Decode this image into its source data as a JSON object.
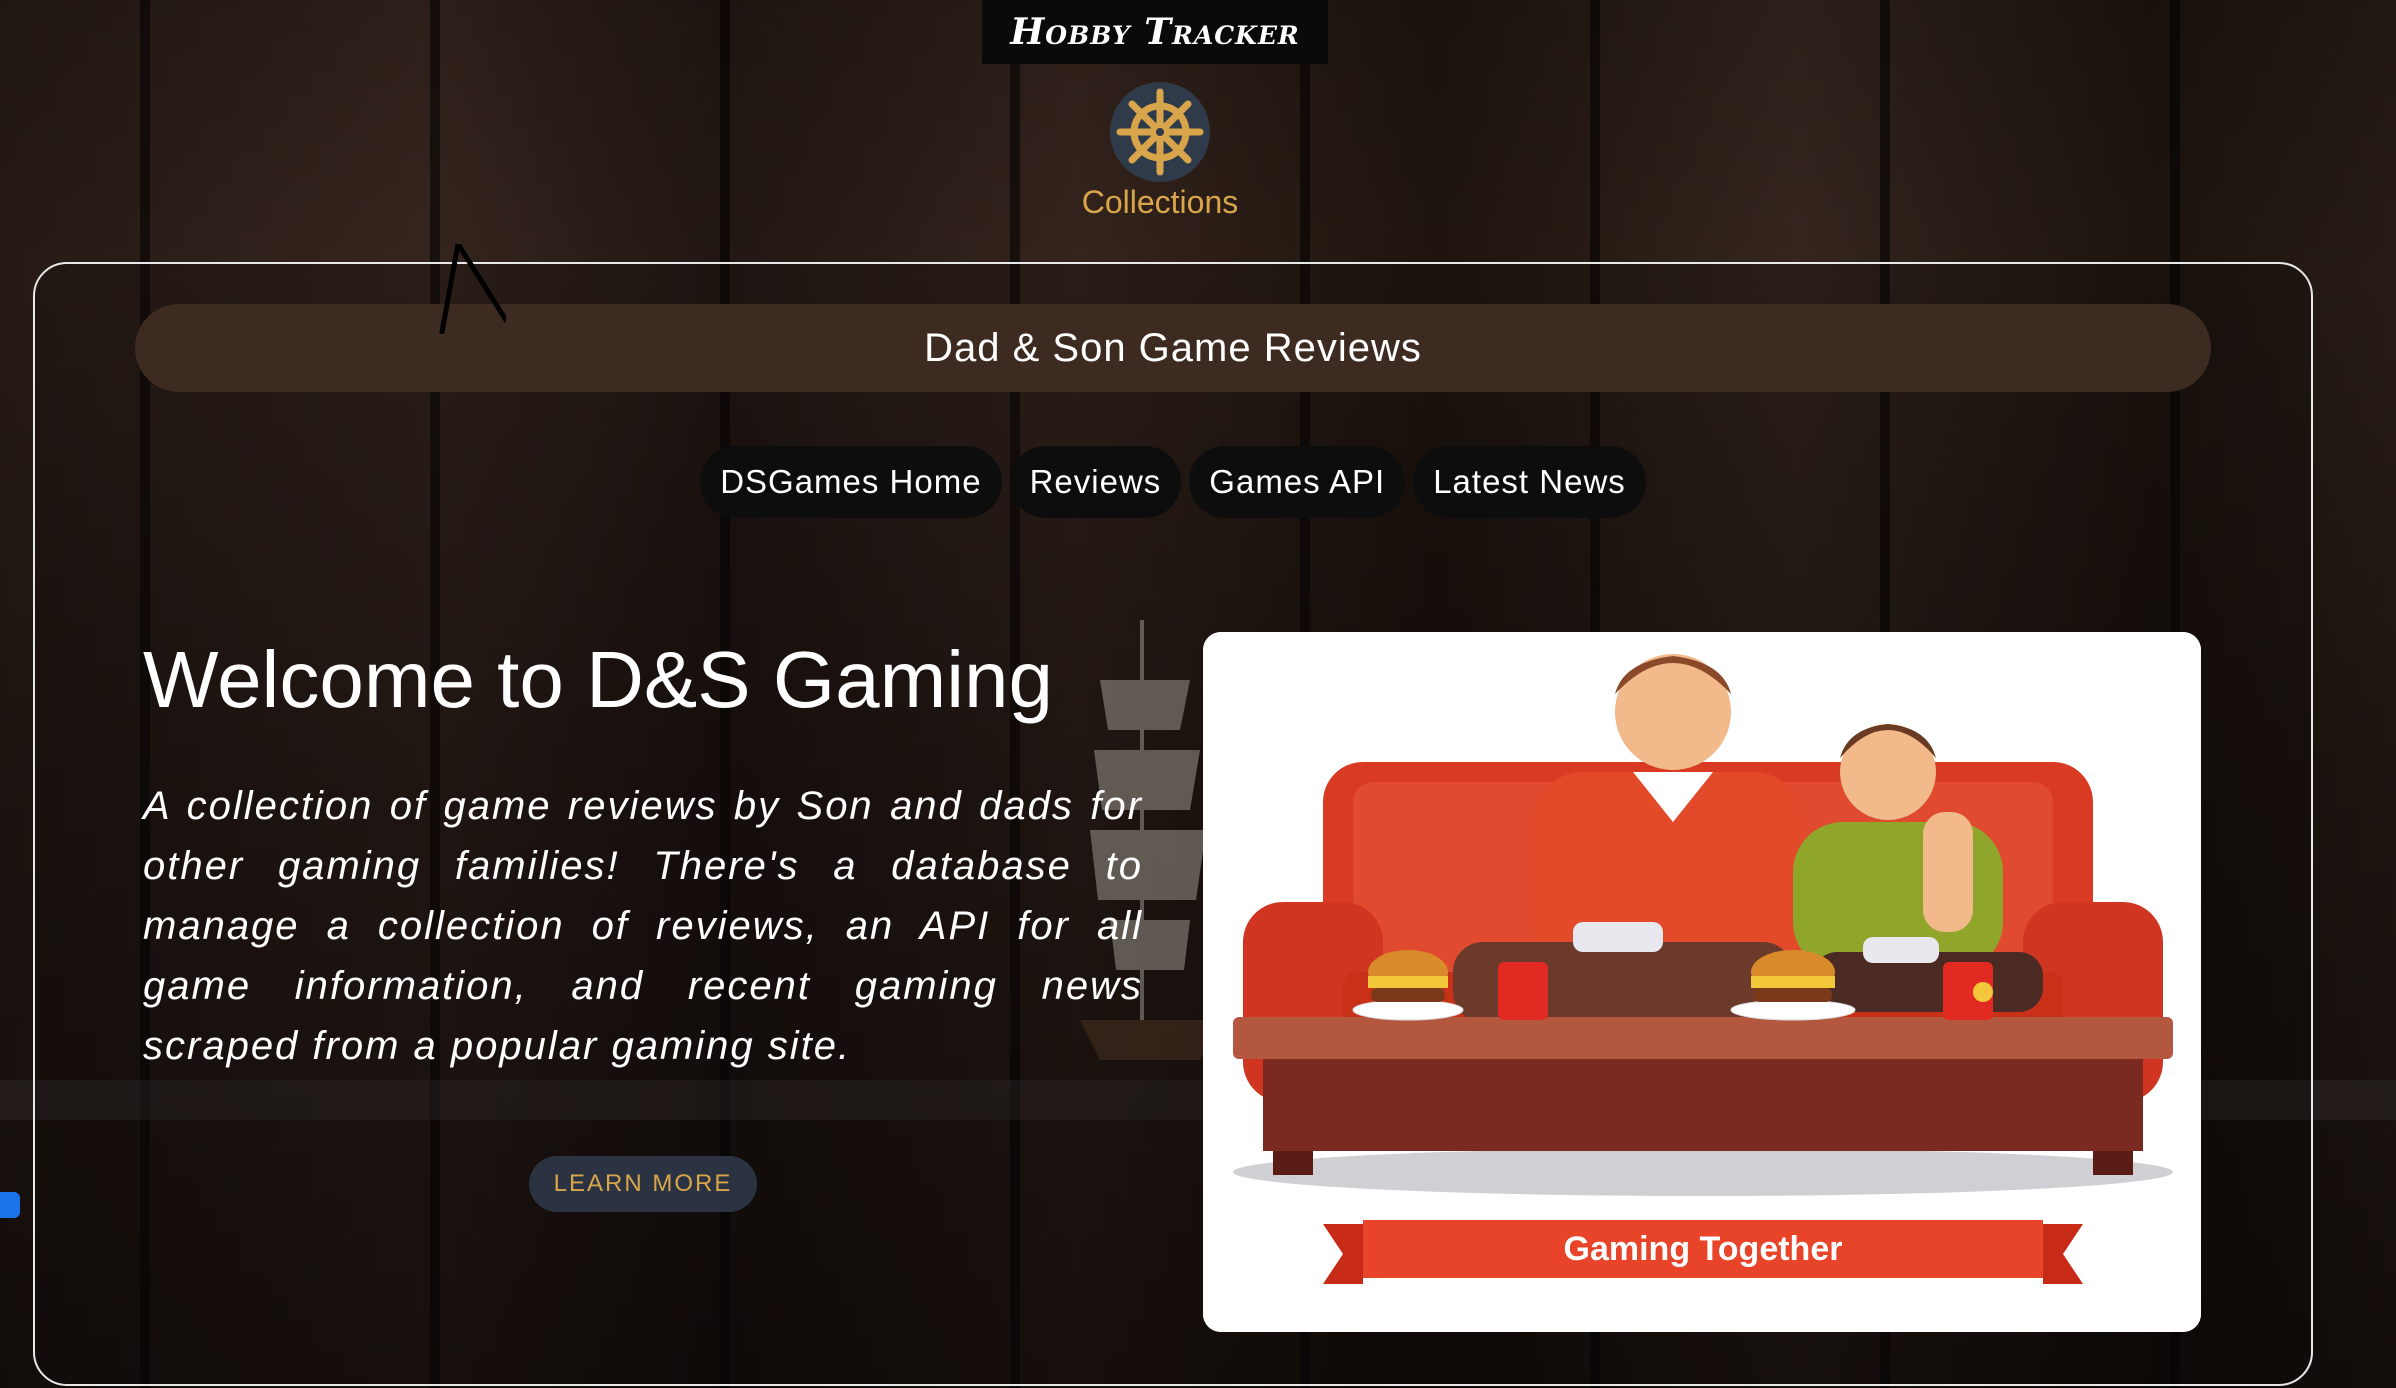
{
  "header": {
    "site_title": "Hobby Tracker",
    "collections_label": "Collections",
    "collections_icon": "ship-wheel-icon"
  },
  "banner": {
    "title": "Dad & Son Game Reviews"
  },
  "nav": {
    "items": [
      {
        "label": "DSGames Home"
      },
      {
        "label": "Reviews"
      },
      {
        "label": "Games API"
      },
      {
        "label": "Latest News"
      }
    ]
  },
  "hero": {
    "heading": "Welcome to D&S Gaming",
    "description": "A collection of game reviews by Son and dads for other gaming families! There's a database to manage a collection of reviews, an API for all game information, and recent gaming news scraped from a popular gaming site.",
    "button_label": "LEARN MORE"
  },
  "illustration": {
    "caption": "Gaming Together"
  },
  "colors": {
    "accent_gold": "#d9a54a",
    "banner_brown": "#3d2b22",
    "ribbon_red": "#e8442a"
  }
}
